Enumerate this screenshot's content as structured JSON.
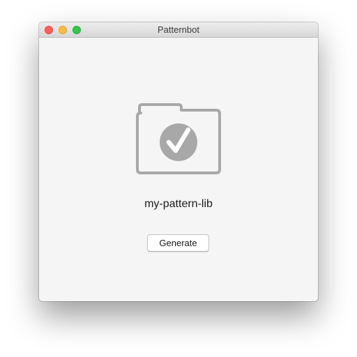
{
  "window": {
    "title": "Patternbot"
  },
  "main": {
    "folder_icon": "folder-check-icon",
    "project_name": "my-pattern-lib",
    "generate_label": "Generate"
  },
  "colors": {
    "icon_gray": "#a8a8a8",
    "traffic_close": "#fc605c",
    "traffic_minimize": "#fdbc40",
    "traffic_maximize": "#34c84a"
  }
}
